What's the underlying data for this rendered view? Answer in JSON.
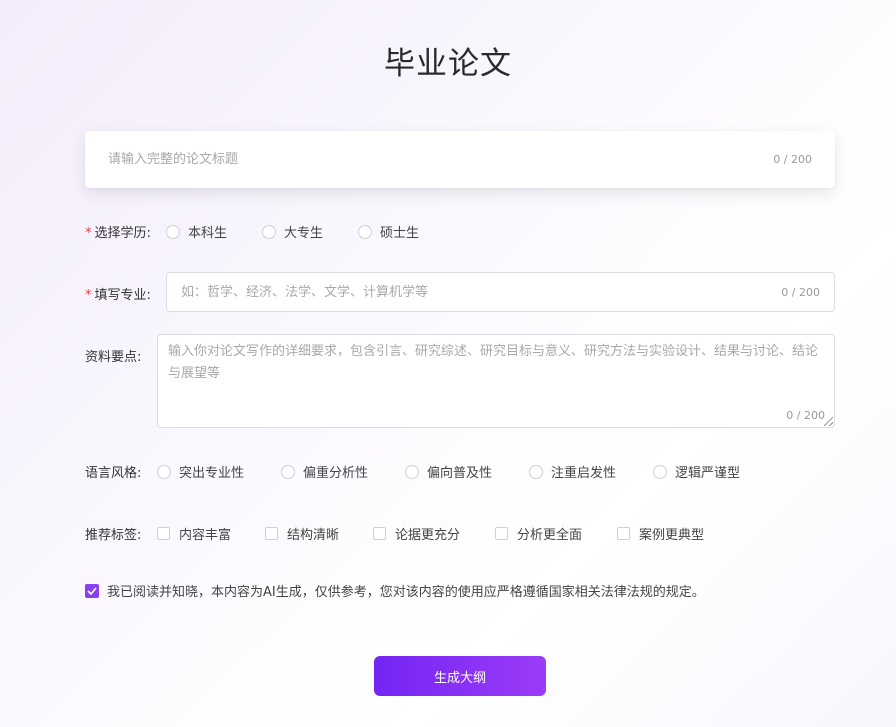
{
  "page": {
    "title": "毕业论文"
  },
  "title_input": {
    "placeholder": "请输入完整的论文标题",
    "counter": "0 / 200"
  },
  "degree": {
    "required": "*",
    "label": "选择学历:",
    "options": [
      "本科生",
      "大专生",
      "硕士生"
    ]
  },
  "major": {
    "required": "*",
    "label": "填写专业:",
    "placeholder": "如：哲学、经济、法学、文学、计算机学等",
    "counter": "0 / 200"
  },
  "notes": {
    "label": "资料要点:",
    "placeholder": "输入你对论文写作的详细要求，包含引言、研究综述、研究目标与意义、研究方法与实验设计、结果与讨论、结论与展望等",
    "counter": "0 / 200"
  },
  "style": {
    "label": "语言风格:",
    "options": [
      "突出专业性",
      "偏重分析性",
      "偏向普及性",
      "注重启发性",
      "逻辑严谨型"
    ]
  },
  "tags": {
    "label": "推荐标签:",
    "options": [
      "内容丰富",
      "结构清晰",
      "论据更充分",
      "分析更全面",
      "案例更典型"
    ]
  },
  "agreement": {
    "checked": true,
    "text": "我已阅读并知晓，本内容为AI生成，仅供参考，您对该内容的使用应严格遵循国家相关法律法规的规定。"
  },
  "generate_button": {
    "label": "生成大纲"
  },
  "colors": {
    "accent": "#8a3ff2",
    "button_start": "#7425f4",
    "button_end": "#9b3cf7",
    "required": "#e63b3b"
  }
}
